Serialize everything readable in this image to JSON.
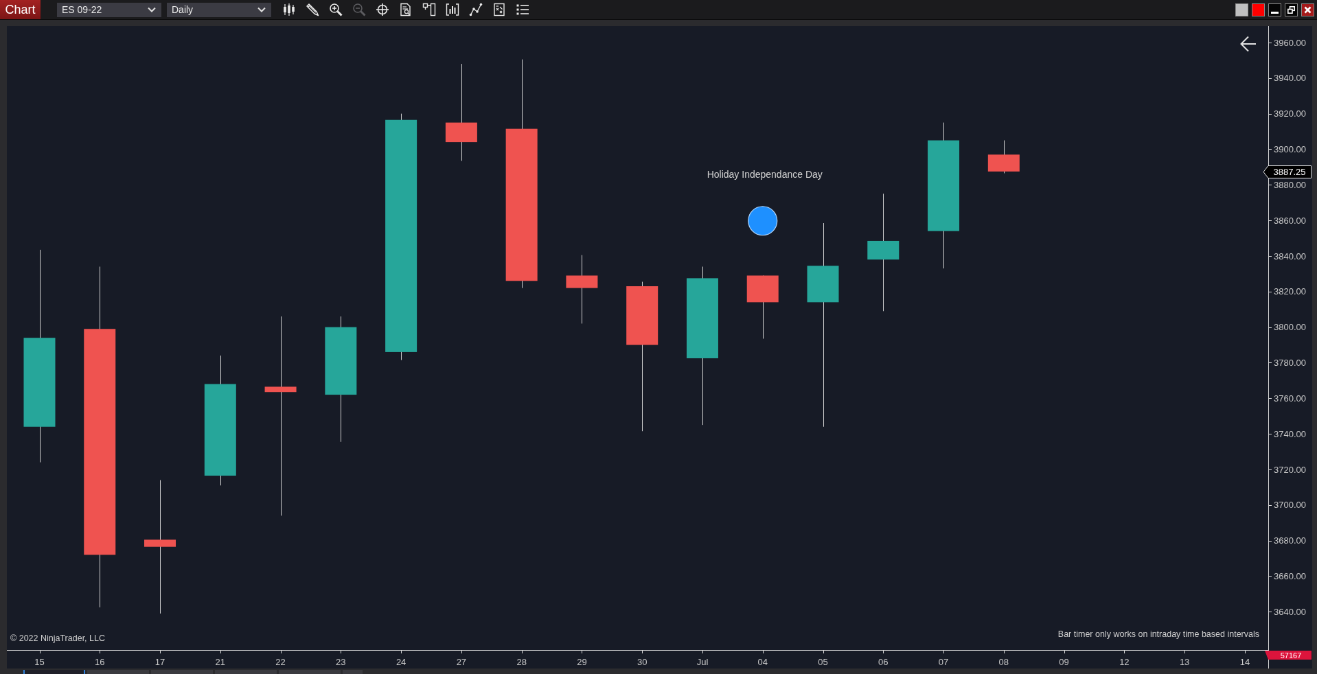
{
  "window": {
    "title": "Chart",
    "link_buttons": [
      {
        "color": "#c0c0c0"
      },
      {
        "color": "#ff0000"
      }
    ]
  },
  "toolbar": {
    "instrument": "ES 09-22",
    "interval": "Daily",
    "tools": [
      {
        "disabled": false
      },
      {
        "disabled": false
      },
      {
        "disabled": false
      },
      {
        "disabled": true
      },
      {
        "disabled": false
      },
      {
        "disabled": false
      },
      {
        "disabled": false
      },
      {
        "disabled": false
      },
      {
        "disabled": false
      },
      {
        "disabled": false
      },
      {
        "disabled": false
      }
    ]
  },
  "chart": {
    "chart_data": {
      "type": "candlestick",
      "categories": [
        "15",
        "16",
        "17",
        "21",
        "22",
        "23",
        "24",
        "27",
        "28",
        "29",
        "30",
        "Jul",
        "04",
        "05",
        "06",
        "07",
        "08",
        "09",
        "12",
        "13",
        "14"
      ],
      "series": [
        {
          "ohlc": [
            [
              3744,
              3843.5,
              3724,
              3794
            ],
            [
              3799,
              3834,
              3642.5,
              3672
            ],
            [
              3680.5,
              3714,
              3639,
              3676.5
            ],
            [
              3716.5,
              3784,
              3711,
              3768
            ],
            [
              3766.5,
              3806,
              3694,
              3763.5
            ],
            [
              3762,
              3806,
              3735.5,
              3800
            ],
            [
              3786,
              3920,
              3781.5,
              3916.5
            ],
            [
              3915,
              3948,
              3893.5,
              3904
            ],
            [
              3911.5,
              3950.5,
              3822,
              3826
            ],
            [
              3829,
              3840.5,
              3802,
              3822
            ],
            [
              3823,
              3825.5,
              3741.5,
              3790
            ],
            [
              3782.5,
              3834,
              3745,
              3827.5
            ],
            [
              3829,
              3829,
              3793.5,
              3814
            ],
            [
              3814,
              3858.5,
              3744,
              3834.5
            ],
            [
              3838,
              3875,
              3809,
              3848.5
            ],
            [
              3854,
              3915,
              3833,
              3905
            ],
            [
              3897,
              3905,
              3886.5,
              3887.5
            ],
            null,
            null,
            null,
            null
          ]
        }
      ],
      "ylim": [
        3618.5,
        3969.25
      ],
      "yticks": [
        {
          "value": 3960,
          "label": "3960.00"
        },
        {
          "value": 3940,
          "label": "3940.00"
        },
        {
          "value": 3920,
          "label": "3920.00"
        },
        {
          "value": 3900,
          "label": "3900.00"
        },
        {
          "value": 3880,
          "label": "3880.00"
        },
        {
          "value": 3860,
          "label": "3860.00"
        },
        {
          "value": 3840,
          "label": "3840.00"
        },
        {
          "value": 3820,
          "label": "3820.00"
        },
        {
          "value": 3800,
          "label": "3800.00"
        },
        {
          "value": 3780,
          "label": "3780.00"
        },
        {
          "value": 3760,
          "label": "3760.00"
        },
        {
          "value": 3740,
          "label": "3740.00"
        },
        {
          "value": 3720,
          "label": "3720.00"
        },
        {
          "value": 3700,
          "label": "3700.00"
        },
        {
          "value": 3680,
          "label": "3680.00"
        },
        {
          "value": 3660,
          "label": "3660.00"
        },
        {
          "value": 3640,
          "label": "3640.00"
        }
      ],
      "annotations": [
        "Holiday Independance Day"
      ]
    },
    "current_price": "3887.25",
    "volume_marker": "57167",
    "copyright": "© 2022 NinjaTrader, LLC",
    "bar_timer_message": "Bar timer only works on intraday time based intervals"
  },
  "tabs": [
    {
      "selected": true
    },
    {
      "selected": false
    },
    {
      "selected": false
    },
    {
      "selected": false
    },
    {
      "selected": false
    },
    {
      "selected": false
    }
  ]
}
